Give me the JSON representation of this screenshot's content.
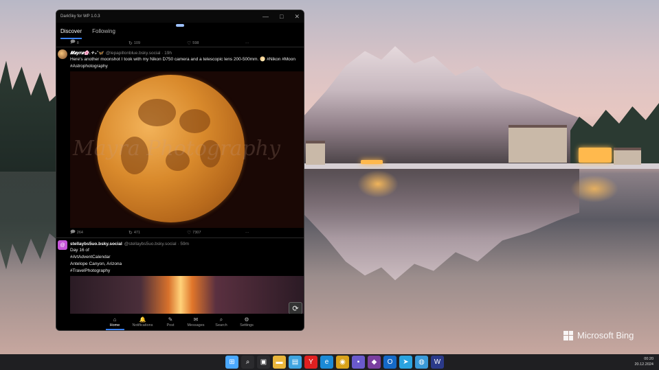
{
  "window": {
    "title": "DarkSky for WP 1.0.3"
  },
  "tabs": [
    {
      "label": "Discover",
      "active": true
    },
    {
      "label": "Following",
      "active": false
    }
  ],
  "prev_post_stats": {
    "replies": "8",
    "reposts": "109",
    "likes": "598",
    "more": "···"
  },
  "posts": [
    {
      "author_name": "𝑴𝒂𝒚𝒓𝒂🌸.✧₊˚🦋",
      "handle_time": "@lepapillonblue.bsky.social · 19h",
      "text": "Here's another moonshot I took with my Nikon D750 camera and a telescopic lens 200-500mm. 🌕 #Nikon #Moon #Astrophotography",
      "image_watermark": "Mayra Photography",
      "stats": {
        "replies": "264",
        "reposts": "471",
        "likes": "7307",
        "more": "···"
      }
    },
    {
      "author_name": "stellaybs5uo.bsky.social",
      "handle_time": "@stellaybs5uo.bsky.social · 59m",
      "lines": [
        "Day 16 of",
        "#ArtAdventCalendar",
        "Antelope Canyon, Arizona",
        "#TravelPhotography"
      ],
      "avatar_glyph": "@"
    }
  ],
  "bottom_nav": [
    {
      "label": "Home",
      "icon": "home-icon",
      "glyph": "⌂",
      "active": true
    },
    {
      "label": "Notifications",
      "icon": "bell-icon",
      "glyph": "🔔",
      "active": false
    },
    {
      "label": "Post",
      "icon": "pencil-icon",
      "glyph": "✎",
      "active": false
    },
    {
      "label": "Messages",
      "icon": "mail-icon",
      "glyph": "✉",
      "active": false
    },
    {
      "label": "Search",
      "icon": "search-icon",
      "glyph": "⌕",
      "active": false
    },
    {
      "label": "Settings",
      "icon": "gear-icon",
      "glyph": "⚙",
      "active": false
    }
  ],
  "desktop": {
    "watermark": "Microsoft Bing"
  },
  "taskbar": {
    "time": "00:20",
    "date": "20.12.2024",
    "icons": [
      {
        "name": "start-icon",
        "glyph": "⊞",
        "color": "#4aa8ff"
      },
      {
        "name": "search-icon",
        "glyph": "⌕",
        "color": "#2b2b2e"
      },
      {
        "name": "task-view-icon",
        "glyph": "▣",
        "color": "#2b2b2e"
      },
      {
        "name": "file-explorer-icon",
        "glyph": "▬",
        "color": "#e9b53b"
      },
      {
        "name": "notepad-icon",
        "glyph": "▤",
        "color": "#3fa4e0"
      },
      {
        "name": "yandex-icon",
        "glyph": "Y",
        "color": "#e02020"
      },
      {
        "name": "edge-icon",
        "glyph": "e",
        "color": "#1b8ad6"
      },
      {
        "name": "chrome-icon",
        "glyph": "◉",
        "color": "#d9a21b"
      },
      {
        "name": "floppy-icon",
        "glyph": "▪",
        "color": "#6a5acd"
      },
      {
        "name": "app-icon",
        "glyph": "◆",
        "color": "#7a3fa0"
      },
      {
        "name": "outlook-icon",
        "glyph": "O",
        "color": "#1569c7"
      },
      {
        "name": "telegram-icon",
        "glyph": "➤",
        "color": "#2aa3e0"
      },
      {
        "name": "globe-icon",
        "glyph": "◍",
        "color": "#3a9ad9"
      },
      {
        "name": "darksky-app-icon",
        "glyph": "W",
        "color": "#2b3a8a"
      }
    ]
  },
  "colors": {
    "accent": "#3b82f6",
    "app_bg": "#000000"
  }
}
